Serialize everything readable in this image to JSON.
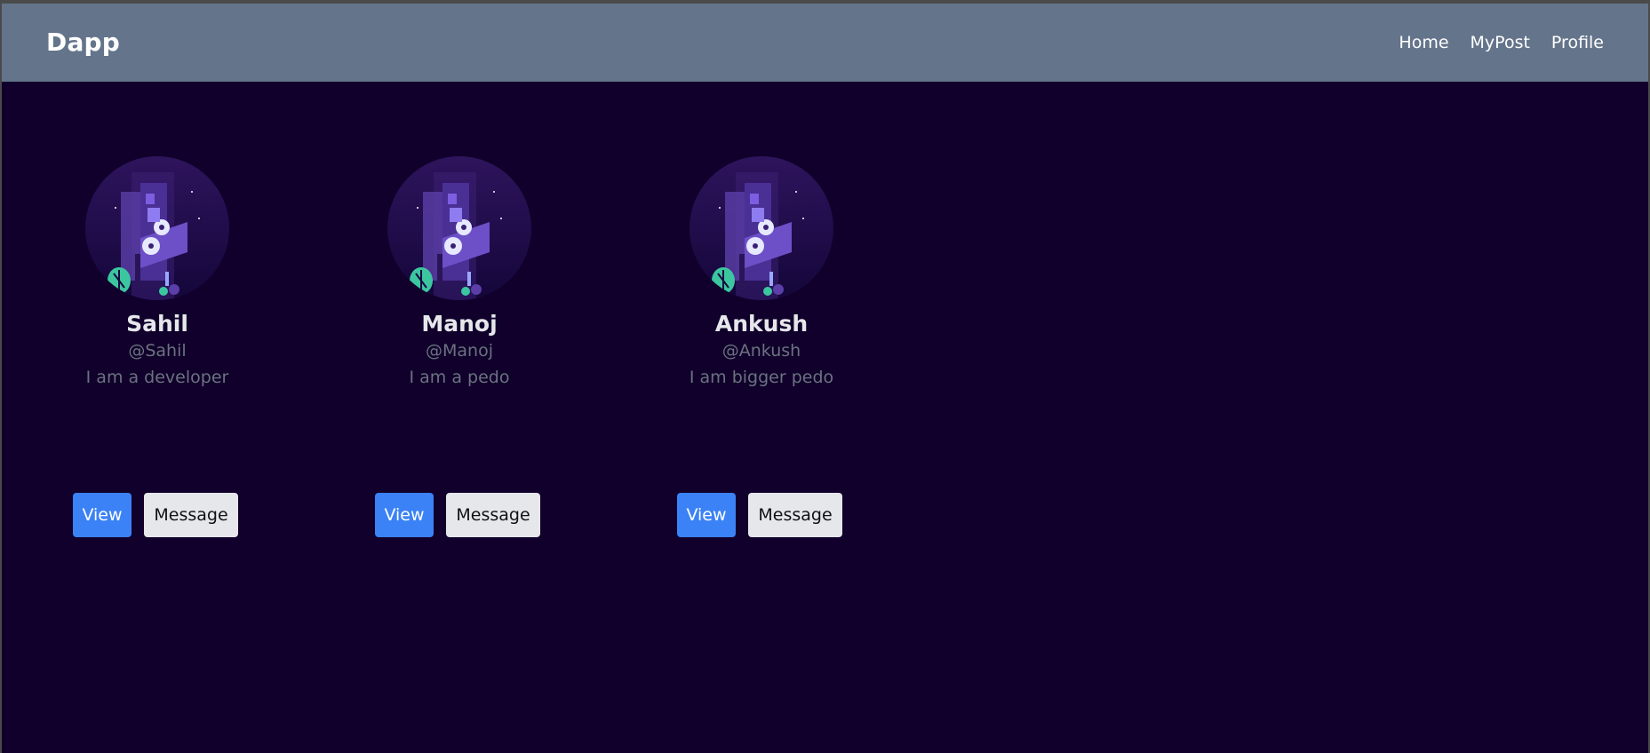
{
  "navbar": {
    "brand": "Dapp",
    "links": [
      "Home",
      "MyPost",
      "Profile"
    ]
  },
  "users": [
    {
      "name": "Sahil",
      "handle": "@Sahil",
      "bio": "I am a developer",
      "view_label": "View",
      "message_label": "Message"
    },
    {
      "name": "Manoj",
      "handle": "@Manoj",
      "bio": "I am a pedo",
      "view_label": "View",
      "message_label": "Message"
    },
    {
      "name": "Ankush",
      "handle": "@Ankush",
      "bio": "I am bigger pedo",
      "view_label": "View",
      "message_label": "Message"
    }
  ],
  "colors": {
    "navbar_bg": "#64748b",
    "page_bg": "#10002b",
    "view_button": "#3b82f6",
    "message_button": "#e5e7eb",
    "name_text": "#e5e7eb",
    "muted_text": "#6b7280"
  },
  "icons": {
    "avatar": "isometric-tech-illustration"
  }
}
